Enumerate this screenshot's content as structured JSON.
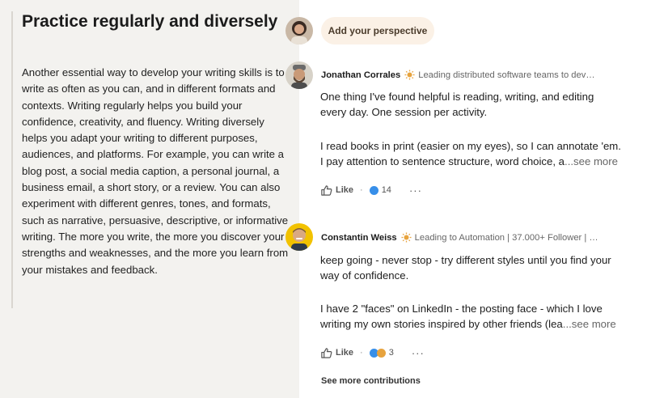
{
  "article": {
    "title": "Practice regularly and diversely",
    "body": "Another essential way to develop your writing skills is to write as often as you can, and in different formats and contexts. Writing regularly helps you build your confidence, creativity, and fluency. Writing diversely helps you adapt your writing to different purposes, audiences, and platforms. For example, you can write a blog post, a social media caption, a personal journal, a business email, a short story, or a review. You can also experiment with different genres, tones, and formats, such as narrative, persuasive, descriptive, or informative writing. The more you write, the more you discover your strengths and weaknesses, and the more you learn from your mistakes and feedback."
  },
  "add_perspective": {
    "label": "Add your perspective"
  },
  "contributions": [
    {
      "author": "Jonathan Corrales",
      "headline": "Leading distributed software teams to dev…",
      "lines": [
        "One thing I've found helpful is reading, writing, and editing",
        "every day. One session per activity.",
        "I read books in print (easier on my eyes), so I can annotate 'em.",
        "I pay attention to sentence structure, word choice, a"
      ],
      "see_more": "...see more",
      "like_label": "Like",
      "reaction_count": "14",
      "more": "···"
    },
    {
      "author": "Constantin Weiss",
      "headline": "Leading to Automation | 37.000+ Follower | …",
      "lines": [
        "keep going - never stop - try different styles until you find your",
        "way of confidence.",
        "I have 2 \"faces\" on LinkedIn - the posting face - which I love",
        "writing my own stories inspired by other friends (lea"
      ],
      "see_more": "...see more",
      "like_label": "Like",
      "reaction_count": "3",
      "more": "···"
    }
  ],
  "see_more_contributions": "See more contributions",
  "colors": {
    "left_bg": "#f3f2ef",
    "button_bg": "#fbf1e6",
    "reaction_blue": "#378fe9",
    "reaction_orange": "#e7a33e"
  }
}
